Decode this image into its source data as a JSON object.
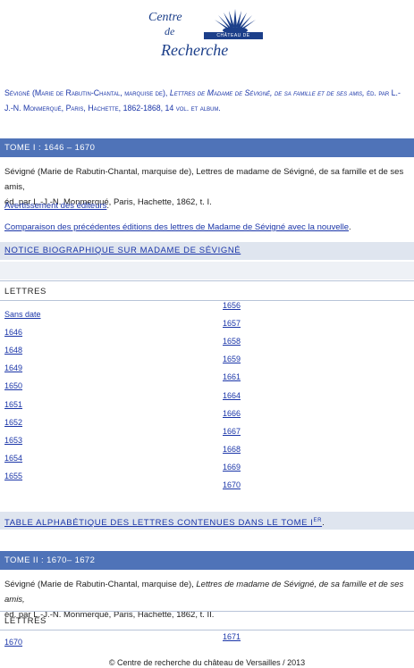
{
  "logo": {
    "line1": "Centre",
    "line2": "de",
    "line3": "Recherche",
    "band": "CHÂTEAU DE VERSAILLES"
  },
  "reference": {
    "part1": "Sévigné (Marie de Rabutin-Chantal, marquise de),",
    "title": "Lettres de Madame de Sévigné, de sa famille et de ses amis,",
    "part2": "éd. par L.-J.-N. Monmerqué, Paris, Hachette, 1862-1868, 14 vol. et album."
  },
  "tome1": {
    "header": "TOME I : 1646 – 1670",
    "desc1": "Sévigné (Marie de Rabutin-Chantal, marquise de), Lettres de madame de Sévigné, de sa famille et de ses amis,",
    "desc2": "éd. par L.-J.-N. Monmerqué, Paris, Hachette, 1862, t. I.",
    "link_avert": "Avertissement des éditeurs",
    "link_avert_suffix": ".",
    "link_comparaison": "Comparaison des précédentes éditions des lettres de Madame de Sévigné avec la nouvelle",
    "link_comparaison_suffix": ".",
    "notice": "NOTICE BIOGRAPHIQUE SUR MADAME DE SÉVIGNÉ",
    "lettres_label": "LETTRES",
    "col1": [
      "Sans date",
      "1646",
      "1648",
      "1649",
      "1650",
      "1651",
      "1652",
      "1653",
      "1654",
      "1655"
    ],
    "col2": [
      "1656",
      "1657",
      "1658",
      "1659",
      "1661",
      "1664",
      "1666",
      "1667",
      "1668",
      "1669",
      "1670"
    ],
    "table_link": "TABLE ALPHABÉTIQUE DES LETTRES CONTENUES DANS LE TOME I",
    "table_sup": "ER",
    "table_suffix": "."
  },
  "tome2": {
    "header": "TOME II : 1670– 1672",
    "desc1a": "Sévigné (Marie de Rabutin-Chantal, marquise de),",
    "desc1b": "Lettres de madame de Sévigné, de sa famille et de ses amis,",
    "desc2": "éd. par L.-J.-N. Monmerqué, Paris, Hachette, 1862, t. II.",
    "lettres_label": "LETTRES",
    "col1": [
      "1670"
    ],
    "col2": [
      "1671"
    ]
  },
  "footer": "© Centre de recherche du château de Versailles / 2013"
}
